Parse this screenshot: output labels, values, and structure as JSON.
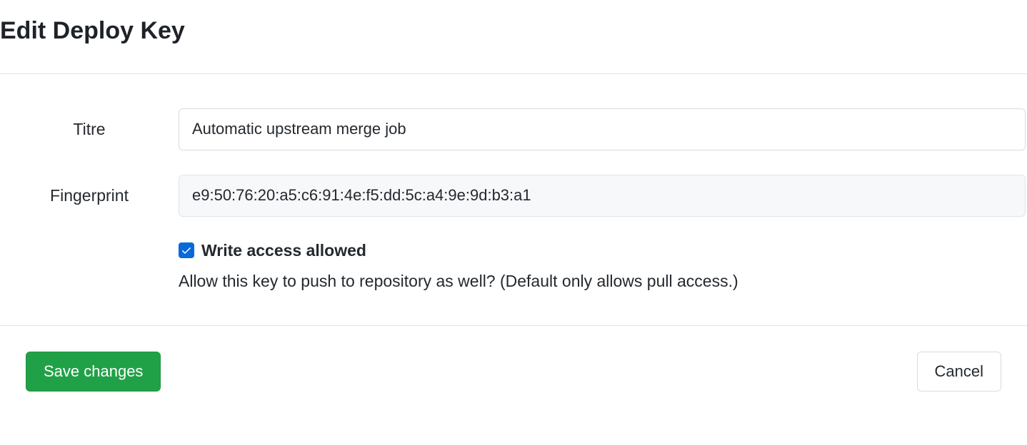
{
  "header": {
    "title": "Edit Deploy Key"
  },
  "form": {
    "title_label": "Titre",
    "title_value": "Automatic upstream merge job",
    "fingerprint_label": "Fingerprint",
    "fingerprint_value": "e9:50:76:20:a5:c6:91:4e:f5:dd:5c:a4:9e:9d:b3:a1",
    "write_access_label": "Write access allowed",
    "write_access_checked": true,
    "write_access_help": "Allow this key to push to repository as well? (Default only allows pull access.)"
  },
  "actions": {
    "save_label": "Save changes",
    "cancel_label": "Cancel"
  }
}
